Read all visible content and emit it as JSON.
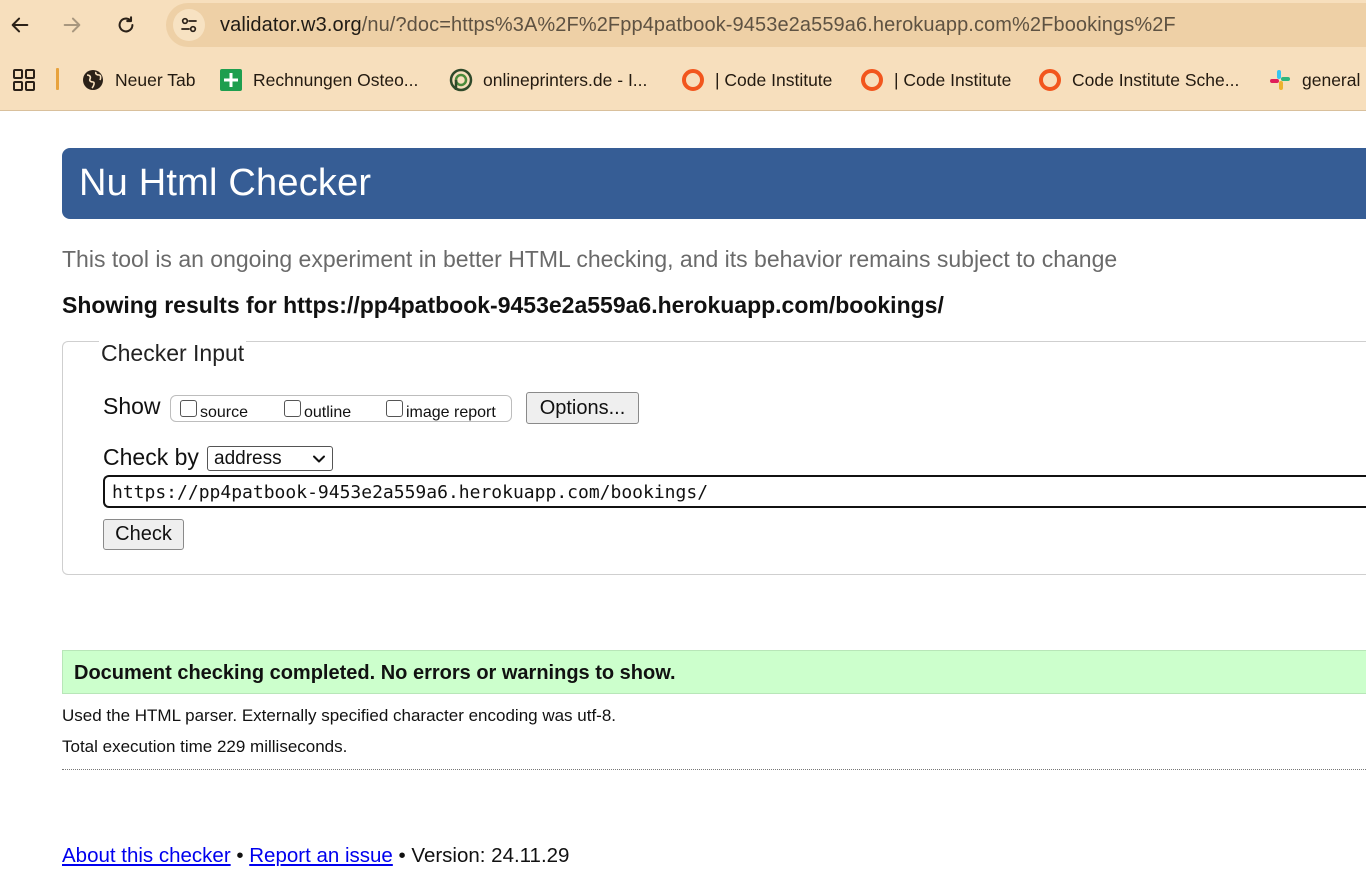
{
  "browser": {
    "url_host": "validator.w3.org",
    "url_path": "/nu/?doc=https%3A%2F%2Fpp4patbook-9453e2a559a6.herokuapp.com%2Fbookings%2F",
    "bookmarks": [
      {
        "label": "Neuer Tab",
        "icon": "globe-icon"
      },
      {
        "label": "Rechnungen Osteo...",
        "icon": "sheets-icon"
      },
      {
        "label": "onlineprinters.de - I...",
        "icon": "onlineprinters-icon"
      },
      {
        "label": "| Code Institute",
        "icon": "code-institute-icon"
      },
      {
        "label": "| Code Institute",
        "icon": "code-institute-icon"
      },
      {
        "label": "Code Institute Sche...",
        "icon": "code-institute-icon"
      },
      {
        "label": "general",
        "icon": "slack-icon"
      }
    ],
    "colors": {
      "chrome": "#f7dfbd",
      "omnibox": "#eed0a6"
    }
  },
  "page": {
    "title": "Nu Html Checker",
    "intro": "This tool is an ongoing experiment in better HTML checking, and its behavior remains subject to change",
    "results_for": "Showing results for https://pp4patbook-9453e2a559a6.herokuapp.com/bookings/",
    "checker": {
      "legend": "Checker Input",
      "show_label": "Show",
      "options": [
        {
          "label": "source",
          "checked": false
        },
        {
          "label": "outline",
          "checked": false
        },
        {
          "label": "image report",
          "checked": false
        }
      ],
      "options_button": "Options...",
      "checkby_label": "Check by",
      "checkby_value": "address",
      "address_value": "https://pp4patbook-9453e2a559a6.herokuapp.com/bookings/",
      "check_button": "Check"
    },
    "success_message": "Document checking completed. No errors or warnings to show.",
    "details": [
      "Used the HTML parser. Externally specified character encoding was utf-8.",
      "Total execution time 229 milliseconds."
    ],
    "footer": {
      "about_link": "About this checker",
      "separator": " • ",
      "report_link": "Report an issue",
      "version": "Version: 24.11.29"
    },
    "colors": {
      "banner": "#365d95",
      "success_bg": "#ccffcc",
      "link": "#0000ee"
    }
  }
}
